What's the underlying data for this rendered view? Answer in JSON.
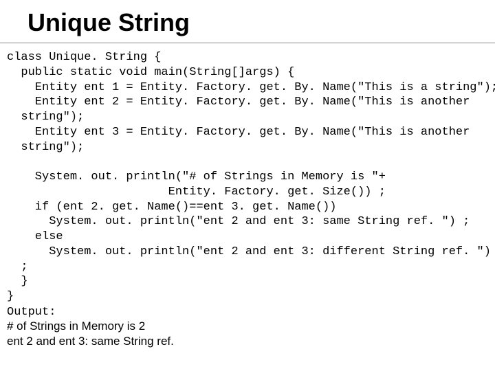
{
  "title": "Unique String",
  "code": "class Unique. String {\n  public static void main(String[]args) {\n    Entity ent 1 = Entity. Factory. get. By. Name(\"This is a string\");\n    Entity ent 2 = Entity. Factory. get. By. Name(\"This is another\n  string\");\n    Entity ent 3 = Entity. Factory. get. By. Name(\"This is another\n  string\");\n\n    System. out. println(\"# of Strings in Memory is \"+\n                       Entity. Factory. get. Size()) ;\n    if (ent 2. get. Name()==ent 3. get. Name())\n      System. out. println(\"ent 2 and ent 3: same String ref. \") ;\n    else\n      System. out. println(\"ent 2 and ent 3: different String ref. \")\n  ;\n  }\n}",
  "output_label": "Output:",
  "output_line1": "# of Strings in Memory is 2",
  "output_line2": "ent 2 and ent 3: same String ref."
}
